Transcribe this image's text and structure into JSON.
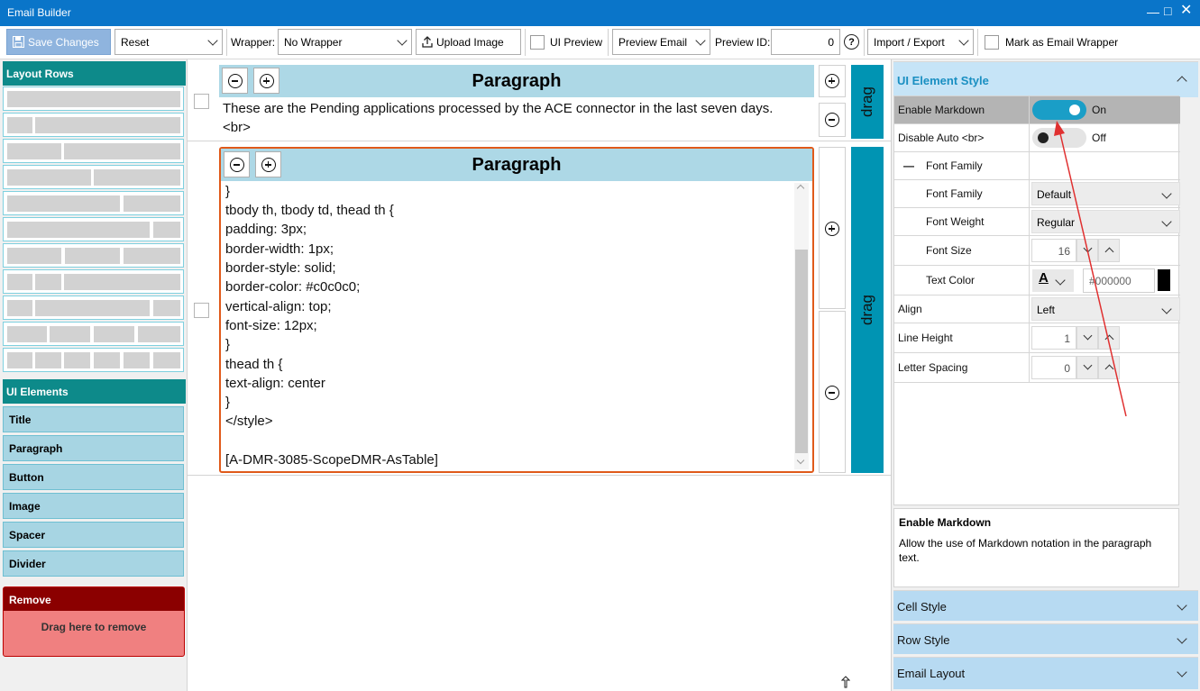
{
  "window": {
    "title": "Email Builder"
  },
  "toolbar": {
    "save_label": "Save Changes",
    "reset_value": "Reset",
    "wrapper_label": "Wrapper:",
    "wrapper_value": "No Wrapper",
    "upload_label": "Upload Image",
    "ui_preview_label": "UI Preview",
    "preview_email_value": "Preview Email",
    "preview_id_label": "Preview ID:",
    "preview_id_value": "0",
    "help_glyph": "?",
    "import_export_value": "Import / Export",
    "mark_wrapper_label": "Mark as Email Wrapper"
  },
  "left": {
    "layout_rows_header": "Layout Rows",
    "ui_elements_header": "UI Elements",
    "elements": [
      "Title",
      "Paragraph",
      "Button",
      "Image",
      "Spacer",
      "Divider"
    ],
    "remove_header": "Remove",
    "remove_hint": "Drag here to remove"
  },
  "canvas": {
    "row1": {
      "title": "Paragraph",
      "text_line1": "These are the Pending applications processed by the ACE connector in the last seven days.",
      "text_line2": "<br>"
    },
    "row2": {
      "title": "Paragraph",
      "code": [
        "}",
        "tbody th, tbody td, thead th {",
        "padding: 3px;",
        "border-width: 1px;",
        "border-style: solid;",
        "border-color: #c0c0c0;",
        "vertical-align: top;",
        "font-size: 12px;",
        "}",
        "thead th {",
        "text-align: center",
        "}",
        "</style>",
        "",
        "[A-DMR-3085-ScopeDMR-AsTable]"
      ]
    },
    "drag_label": "drag"
  },
  "right": {
    "ui_element_style": "UI Element Style",
    "props": {
      "enable_markdown": {
        "label": "Enable Markdown",
        "value": "On"
      },
      "disable_auto_br": {
        "label": "Disable Auto <br>",
        "value": "Off"
      },
      "font_family_group": {
        "label": "Font Family",
        "collapse_glyph": "—"
      },
      "font_family": {
        "label": "Font Family",
        "value": "Default"
      },
      "font_weight": {
        "label": "Font Weight",
        "value": "Regular"
      },
      "font_size": {
        "label": "Font Size",
        "value": "16"
      },
      "text_color": {
        "label": "Text Color",
        "value": "#000000",
        "swatch": "#000000",
        "glyph": "A"
      },
      "align": {
        "label": "Align",
        "value": "Left"
      },
      "line_height": {
        "label": "Line Height",
        "value": "1"
      },
      "letter_spacing": {
        "label": "Letter Spacing",
        "value": "0"
      }
    },
    "description": {
      "title": "Enable Markdown",
      "text": "Allow the use of Markdown notation in the paragraph text."
    },
    "sections": [
      "Cell Style",
      "Row Style",
      "Email Layout"
    ]
  },
  "colors": {
    "titlebar": "#0a75c9",
    "teal_header": "#0d8a8a",
    "toggle_on": "#1a9ec7",
    "drag_bar": "#0094b3",
    "remove_head": "#8b0000",
    "selected_border": "#e05a1a"
  }
}
